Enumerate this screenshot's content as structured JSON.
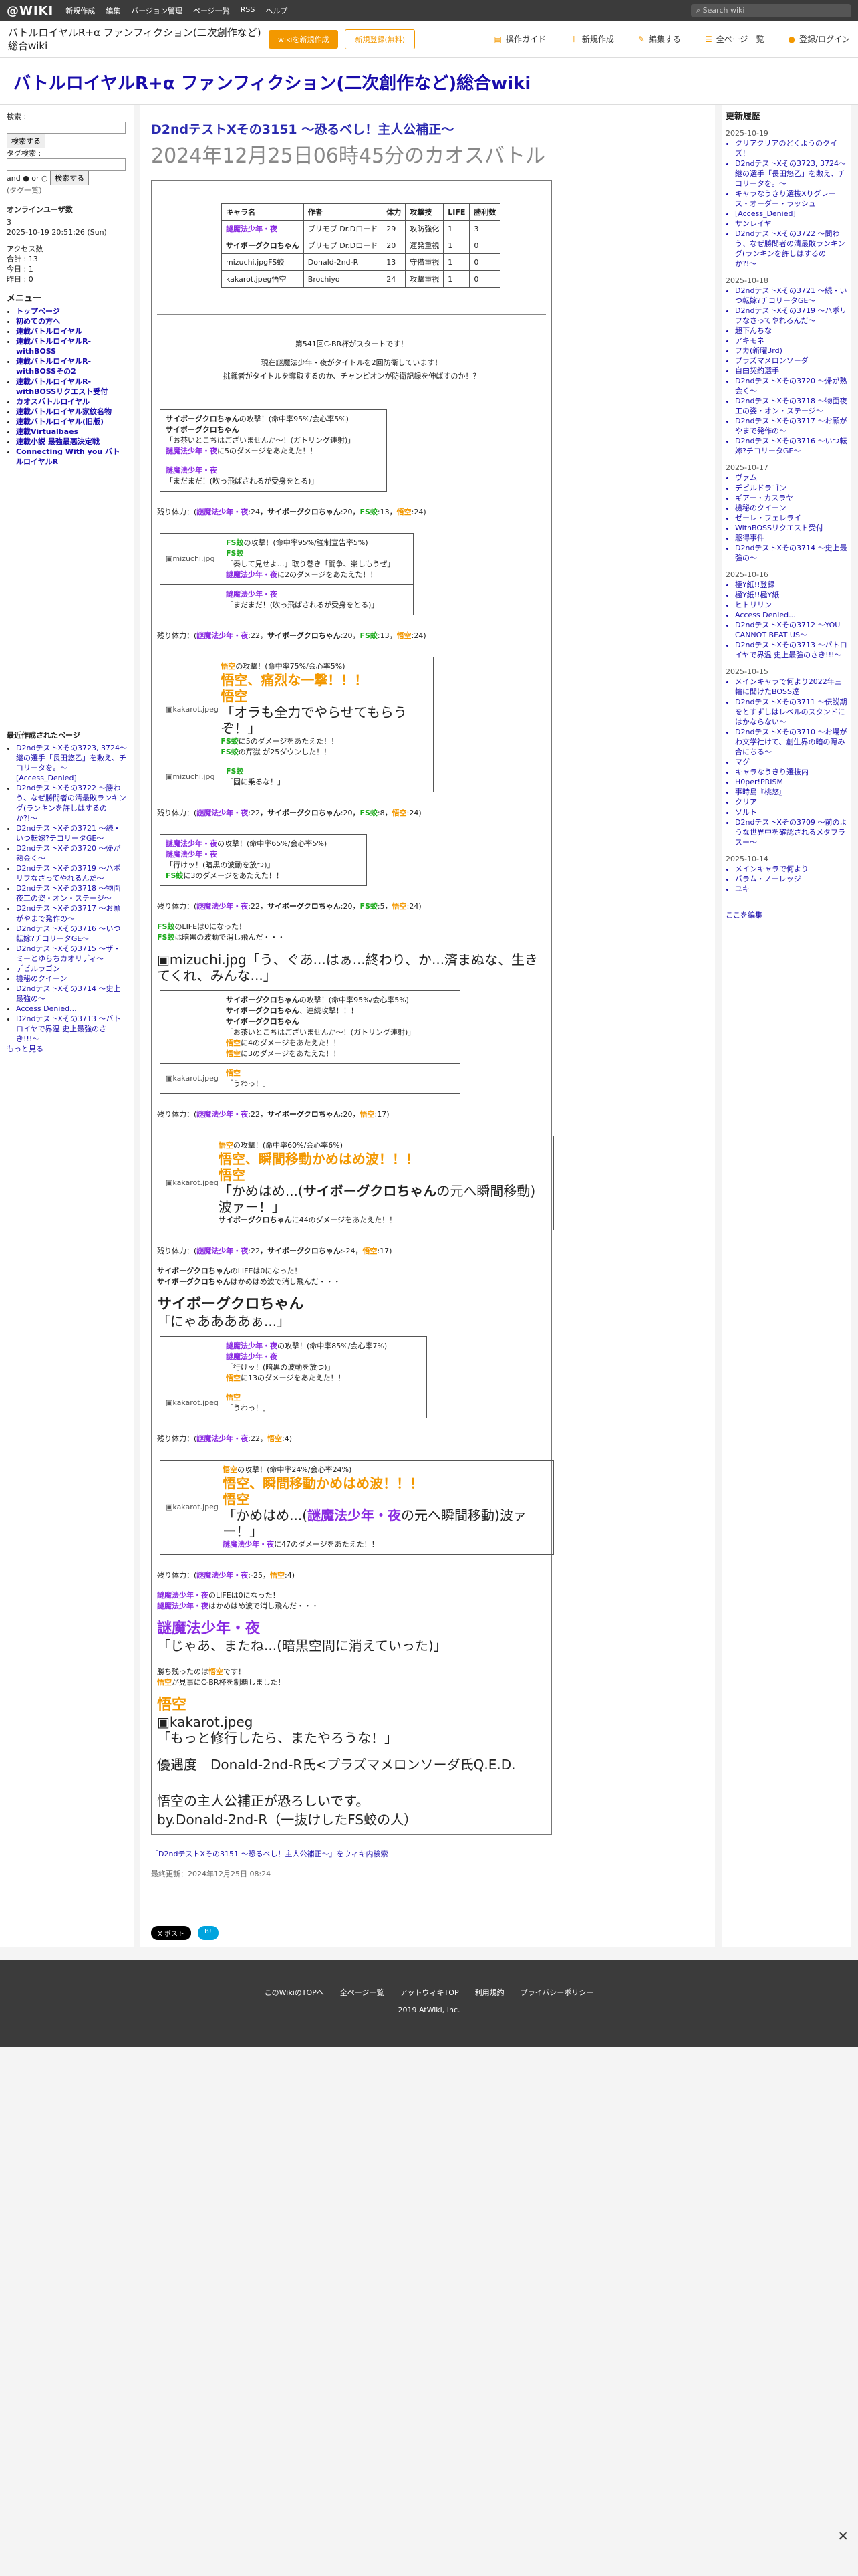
{
  "topbar": {
    "logo": "@WIKI",
    "menu": [
      "新規作成",
      "編集",
      "バージョン管理",
      "ページ一覧",
      "RSS",
      "ヘルプ"
    ],
    "search_placeholder": "Search wiki"
  },
  "header": {
    "wiki_title": "バトルロイヤルR+α ファンフィクション(二次創作など)総合wiki",
    "btn_wiki": "wikiを新規作成",
    "btn_login": "新規登録(無料)",
    "tools": [
      "操作ガイド",
      "新規作成",
      "編集する",
      "全ページ一覧",
      "登録/ログイン"
    ]
  },
  "site_title": "バトルロイヤルR+α ファンフィクション(二次創作など)総合wiki",
  "left": {
    "search_label": "検索 :",
    "search_btn": "検索する",
    "tag_label": "タグ検索 :",
    "tag_btn": "検索する",
    "and_or": "and ● or ○",
    "tag_list": "(タグ一覧)",
    "online_title": "オンラインユーザ数",
    "online_val": "3",
    "online_time": "2025-10-19 20:51:26 (Sun)",
    "access_title": "アクセス数",
    "access_total": "合計 : 13",
    "access_today": "今日 : 1",
    "access_yesterday": "昨日 : 0",
    "menu_title": "メニュー",
    "menu_items": [
      "トップページ",
      "初めての方へ",
      "連載バトルロイヤル",
      "連載バトルロイヤルR-withBOSS",
      "連載バトルロイヤルR-withBOSSその2",
      "連載バトルロイヤルR-withBOSSリクエスト受付",
      "カオスバトルロイヤル",
      "連載バトルロイヤル家紋名物",
      "連載バトルロイヤル(旧版)",
      "連載Virtualbaes",
      "連載小説 最強最悪決定戦",
      "Connecting With you バトルロイヤルR"
    ],
    "recent_title": "最近作成されたページ",
    "recent_items": [
      "D2ndテストXその3723, 3724〜継の選手「長田悠乙」を敷え、チコリータを。〜 [Access_Denied]",
      "D2ndテストXその3722 〜勝わう、なぜ勝問者の清最敗ランキング(ランキンを許しはするのか?!〜",
      "D2ndテストXその3721 〜続・いつ転嫁?チコリータGE〜",
      "D2ndテストXその3720 〜帰が熟会く〜",
      "D2ndテストXその3719 〜ハポリフなさってやれるんだ〜",
      "D2ndテストXその3718 〜物面夜工の姿・オン・ステージ〜",
      "D2ndテストXその3717 〜お願がやまで発作の〜",
      "D2ndテストXその3716 〜いつ転嫁?チコリータGE〜",
      "D2ndテストXその3715 〜ザ・ミーとゆらちカオリディ〜",
      "デビルラゴン",
      "機秘のクイーン",
      "D2ndテストXその3714 〜史上最強の〜",
      "Access Denied...",
      "D2ndテストXその3713 〜バトロイヤで界温 史上最強のさき!!!〜"
    ],
    "more": "もっと見る"
  },
  "main": {
    "title": "D2ndテストXその3151 〜恐るベし！主人公補正〜",
    "subtitle": "2024年12月25日06時45分のカオスバトル",
    "table_headers": [
      "キャラ名",
      "作者",
      "体力",
      "攻撃技",
      "LIFE",
      "勝利数"
    ],
    "table_rows": [
      [
        "謎魔法少年・夜",
        "ブリモプ Dr.Dロード",
        "29",
        "攻防強化",
        "1",
        "3"
      ],
      [
        "サイボーグクロちゃん",
        "ブリモプ Dr.Dロード",
        "20",
        "運発重視",
        "1",
        "0"
      ],
      [
        "mizuchi.jpgFS蛟",
        "Donald-2nd-R",
        "13",
        "守備重視",
        "1",
        "0"
      ],
      [
        "kakarot.jpeg悟空",
        "Brochiyo",
        "24",
        "攻撃重視",
        "1",
        "0"
      ]
    ],
    "intro1": "第541回C-BR杯がスタートです！",
    "intro2": "現在謎魔法少年・夜がタイトルを2回防衛しています！",
    "intro3": "挑戦者がタイトルを奪取するのか、チャンピオンが防衛記録を伸ばすのか！？",
    "end_title": "悟空の主人公補正が恐ろしいです。",
    "end_by": "by.Donald-2nd-R（一抜けしたFS蛟の人）",
    "last_updated": "最終更新：2024年12月25日 08:24",
    "footer_link": "「D2ndテストXその3151 〜恐るベし！主人公補正〜」をウィキ内検索",
    "share": [
      "X ポスト",
      "B!"
    ]
  },
  "right": {
    "title": "更新履歴",
    "groups": [
      {
        "date": "2025-10-19",
        "items": [
          "クリアクリアのどくようのクイズ！",
          "D2ndテストXその3723, 3724〜継の選手「長田悠乙」を敷え、チコリータを。〜",
          "キャラなうきり選抜Xりグレース・オーダー・ラッシュ",
          "[Access_Denied]",
          "サンレイヤ",
          "D2ndテストXその3722 〜問わう、なぜ勝問者の清最敗ランキング(ランキンを許しはするのか?!〜"
        ]
      },
      {
        "date": "2025-10-18",
        "items": [
          "D2ndテストXその3721 〜続・いつ転嫁?チコリータGE〜",
          "D2ndテストXその3719 〜ハポリフなさってやれるんだ〜",
          "超下んちな",
          "アキモネ",
          "フカ(新曜3rd)",
          "プラズマメロンソーダ",
          "自由契約選手",
          "D2ndテストXその3720 〜帰が熟会く〜",
          "D2ndテストXその3718 〜物面夜工の姿・オン・ステージ〜",
          "D2ndテストXその3717 〜お願がやまで発作の〜",
          "D2ndテストXその3716 〜いつ転嫁?チコリータGE〜"
        ]
      },
      {
        "date": "2025-10-17",
        "items": [
          "ヴァム",
          "デビルドラゴン",
          "ギアー・カスラヤ",
          "機秘のクイーン",
          "ゼーレ・フェレライ",
          "WithBOSSリクエスト受付",
          "駆得事件",
          "D2ndテストXその3714 〜史上最強の〜"
        ]
      },
      {
        "date": "2025-10-16",
        "items": [
          "極Y紙!!登録",
          "極Y紙!!極Y紙",
          "ヒトリリン",
          "Access Denied...",
          "D2ndテストXその3712 〜YOU CANNOT BEAT US〜",
          "D2ndテストXその3713 〜バトロイヤで界温 史上最強のさき!!!〜"
        ]
      },
      {
        "date": "2025-10-15",
        "items": [
          "メインキャラで何より2022年三輪に聞けたBOSS達",
          "D2ndテストXその3711 〜伝説期をとすずしはレベルのスタンドにはかならない〜",
          "D2ndテストXその3710 〜お場がわ文学社けて、創生界の暗の隠み合にちる〜",
          "マグ",
          "キャラなうきり選抜内",
          "H0per!PRISM",
          "事時島『桃悠』",
          "クリア",
          "ソルト",
          "D2ndテストXその3709 〜前のような世界中を確認されるメタフラスー〜"
        ]
      },
      {
        "date": "2025-10-14",
        "items": [
          "メインキャラで何より",
          "パラム・ノーレッジ",
          "ユキ"
        ]
      }
    ],
    "edit": "ここを編集"
  },
  "bottom": {
    "links": [
      "このWikiのTOPへ",
      "全ページ一覧",
      "アットウィキTOP",
      "利用規約",
      "プライバシーポリシー"
    ],
    "copy": "2019 AtWiki, Inc."
  }
}
